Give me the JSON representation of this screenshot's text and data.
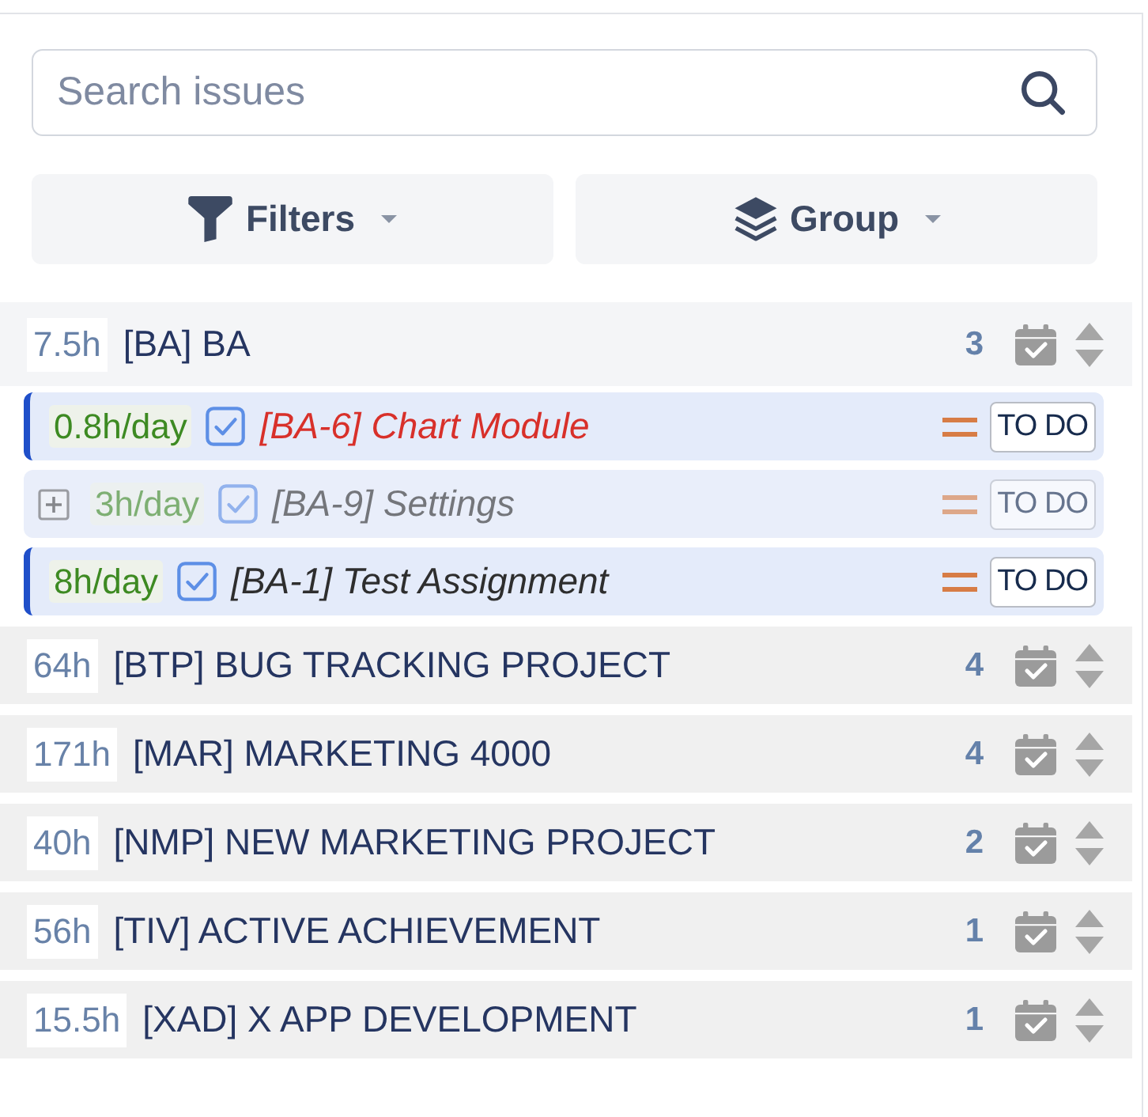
{
  "search": {
    "placeholder": "Search issues"
  },
  "toolbar": [
    {
      "kind": "filter",
      "label": "Filters"
    },
    {
      "kind": "group",
      "label": "Group"
    }
  ],
  "groups": [
    {
      "hours": "7.5h",
      "title": "[BA] BA",
      "count": "3",
      "expanded": true,
      "issues": [
        {
          "kind": "task",
          "rate": "0.8h/day",
          "title": "[BA-6] Chart Module",
          "selected": true,
          "overdue": true,
          "has_subtasks": false,
          "status": "TO DO"
        },
        {
          "kind": "task",
          "rate": "3h/day",
          "title": "[BA-9] Settings",
          "selected": false,
          "overdue": false,
          "has_subtasks": true,
          "status": "TO DO"
        },
        {
          "kind": "task",
          "rate": "8h/day",
          "title": "[BA-1] Test Assignment",
          "selected": true,
          "overdue": false,
          "has_subtasks": false,
          "status": "TO DO"
        }
      ]
    },
    {
      "hours": "64h",
      "title": "[BTP] BUG TRACKING PROJECT",
      "count": "4",
      "expanded": false
    },
    {
      "hours": "171h",
      "title": "[MAR] MARKETING 4000",
      "count": "4",
      "expanded": false
    },
    {
      "hours": "40h",
      "title": "[NMP] NEW MARKETING PROJECT",
      "count": "2",
      "expanded": false
    },
    {
      "hours": "56h",
      "title": "[TIV] ACTIVE ACHIEVEMENT",
      "count": "1",
      "expanded": false
    },
    {
      "hours": "15.5h",
      "title": "[XAD] X APP DEVELOPMENT",
      "count": "1",
      "expanded": false
    }
  ]
}
